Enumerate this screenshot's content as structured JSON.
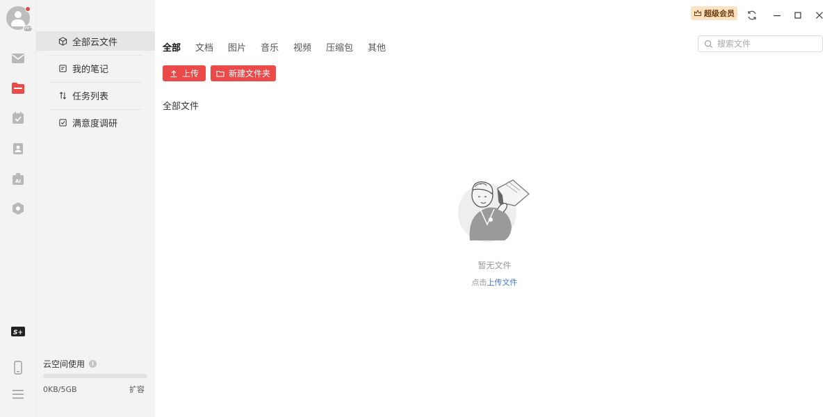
{
  "rail": {
    "avatar_badge": "99+",
    "icons": [
      "mail-icon",
      "folder-icon",
      "calendar-icon",
      "contact-icon",
      "ai-icon",
      "hexagon-icon",
      "s-plus-logo-icon",
      "phone-icon",
      "menu-icon"
    ],
    "logo_text": "S+",
    "ai_text": "AI"
  },
  "sidebar": {
    "items": [
      {
        "label": "全部云文件",
        "icon": "cube-icon",
        "active": true
      },
      {
        "label": "我的笔记",
        "icon": "note-icon",
        "active": false
      },
      {
        "label": "任务列表",
        "icon": "sort-icon",
        "active": false
      },
      {
        "label": "满意度调研",
        "icon": "checkbox-icon",
        "active": false
      }
    ],
    "storage": {
      "label": "云空间使用",
      "info_icon": "i",
      "used": "0KB/5GB",
      "used_fraction": 0,
      "expand": "扩容"
    }
  },
  "header": {
    "vip_label": "超级会员",
    "search_placeholder": "搜索文件"
  },
  "tabs": [
    {
      "label": "全部",
      "active": true
    },
    {
      "label": "文档",
      "active": false
    },
    {
      "label": "图片",
      "active": false
    },
    {
      "label": "音乐",
      "active": false
    },
    {
      "label": "视频",
      "active": false
    },
    {
      "label": "压缩包",
      "active": false
    },
    {
      "label": "其他",
      "active": false
    }
  ],
  "actions": {
    "upload": "上传",
    "new_folder": "新建文件夹"
  },
  "content": {
    "section_title": "全部文件",
    "empty_text": "暂无文件",
    "hint_prefix": "点击",
    "hint_link": "上传文件"
  },
  "colors": {
    "accent": "#ea4a48",
    "link": "#3e7bd8",
    "vip_bg": "#fde2c2",
    "sidebar_bg": "#f3f3f3"
  }
}
